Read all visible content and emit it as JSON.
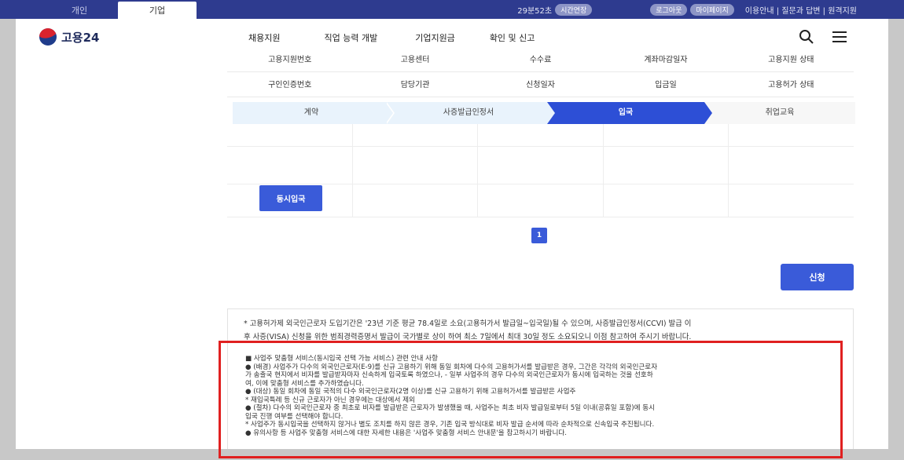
{
  "topbar": {
    "tabs": [
      "개인",
      "기업"
    ],
    "timer": "29분52초",
    "extend_label": "시간연장",
    "logout_label": "로그아웃",
    "mypage_label": "마이페이지",
    "links": "이용안내 | 질문과 답변 | 원격지원"
  },
  "header": {
    "logo_text": "고용24",
    "nav": [
      "채용지원",
      "직업 능력 개발",
      "기업지원금",
      "확인 및 신고"
    ],
    "search_icon": "search-icon",
    "menu_icon": "menu-icon"
  },
  "info_table": {
    "row1": [
      "고용지원번호",
      "고용센터",
      "수수료",
      "계좌마감일자",
      "고용지원 상태"
    ],
    "row2": [
      "구인인증번호",
      "담당기관",
      "신청일자",
      "입금일",
      "고용허가 상태"
    ]
  },
  "steps": [
    "계약",
    "사증발급인정서",
    "입국",
    "취업교육"
  ],
  "active_step": "입국",
  "actions": {
    "simultaneous_entry": "동시입국",
    "page": "1",
    "apply": "신청"
  },
  "notice": {
    "line1": "* 고용허가제 외국인근로자 도입기간은 '23년 기준 평균 78.4일로 소요(고용허가서 발급일~입국일)될 수 있으며, 사증발급인정서(CCVI) 발급 이",
    "line2": "후 사증(VISA) 신청을 위한 범죄경력증명서 발급이 국가별로 상이 하여 최소 7일에서 최대 30일 정도 소요되오니 이점 참고하여 주시기 바랍니다.",
    "details": [
      "■ 사업주 맞춤형 서비스(동시입국 선택 가능 서비스) 관련 안내 사항",
      "● (배경) 사업주가 다수의 외국인근로자(E-9)를 신규 고용하기 위해 동일 회차에 다수의 고용허가서를 발급받은 경우, 그간은 각각의 외국인근로자",
      "가 송출국 현지에서 비자를 발급받자마자 신속하게 입국토록 하였으나, - 일부 사업주의 경우 다수의 외국인근로자가 동시에 입국하는 것을 선호하",
      "여, 이에 맞춤형 서비스를 추가하였습니다.",
      "● (대상) 동일 회차에 동일 국적의 다수 외국인근로자(2명 이상)를 신규 고용하기 위해 고용허가서를 발급받은 사업주",
      "* 재입국특례 등 신규 근로자가 아닌 경우에는 대상에서 제외",
      "● (절차) 다수의 외국인근로자 중 최초로 비자를 발급받은 근로자가 발생했을 때, 사업주는 최초 비자 발급일로부터 5일 이내(공휴일 포함)에 동시",
      "입국 진행 여부를 선택해야 합니다.",
      "* 사업주가 동시입국을 선택하지 않거나 별도 조치를 하지 않은 경우, 기존 입국 방식대로 비자 발급 순서에 따라 순차적으로 신속입국 추진됩니다.",
      "● 유의사항 등 사업주 맞춤형 서비스에 대한 자세한 내용은 '사업주 맞춤형 서비스 안내문'을 참고하시기 바랍니다."
    ]
  },
  "colors": {
    "topbar": "#2e3b8f",
    "accent": "#3a5bd9",
    "step_active": "#2d4fd6",
    "step_done": "#e9f3fc",
    "highlight": "#e02020"
  }
}
